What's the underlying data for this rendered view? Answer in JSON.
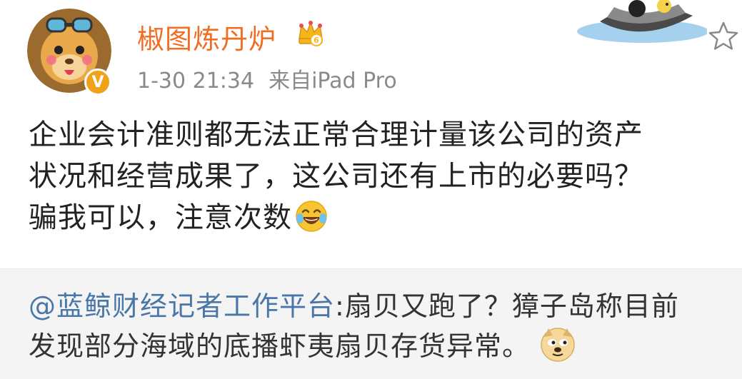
{
  "post": {
    "username": "椒图炼丹炉",
    "timestamp": "1-30 21:34",
    "source": "来自iPad Pro",
    "vip_mark": "V",
    "body_lines": [
      "企业会计准则都无法正常合理计量该公司的资产",
      "状况和经营成果了，这公司还有上市的必要吗？",
      "骗我可以，注意次数"
    ]
  },
  "repost": {
    "user": "@蓝鲸财经记者工作平台",
    "line1_text": ":扇贝又跑了？獐子岛称目前",
    "line2_text": "发现部分海域的底播虾夷扇贝存货异常。"
  },
  "icons": {
    "crown": "crown-icon",
    "star": "star-icon",
    "laugh": "laugh-cry-emoji-icon",
    "doge": "doge-emoji-icon"
  },
  "colors": {
    "username": "#f26d24",
    "meta": "#8a8a8a",
    "link": "#4a76a8",
    "repost_bg": "#f4f4f4"
  }
}
